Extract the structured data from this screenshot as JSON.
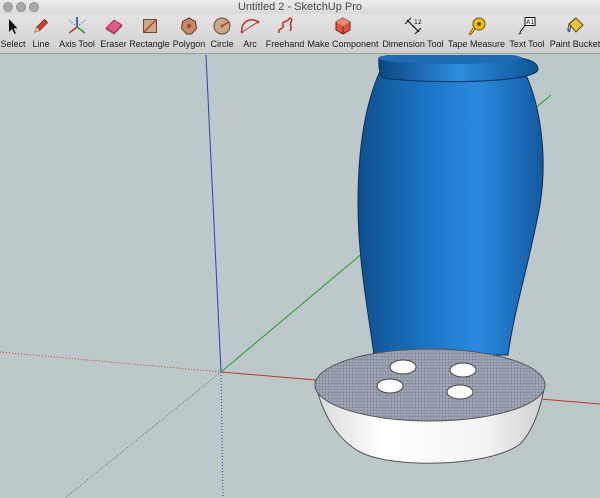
{
  "window": {
    "title": "Untitled 2 - SketchUp Pro"
  },
  "toolbar": {
    "tools": [
      {
        "label": "Select",
        "icon": "select-arrow-icon"
      },
      {
        "label": "Line",
        "icon": "pencil-icon"
      },
      {
        "label": "Axis Tool",
        "icon": "axis-icon"
      },
      {
        "label": "Eraser",
        "icon": "eraser-icon"
      },
      {
        "label": "Rectangle",
        "icon": "rectangle-icon"
      },
      {
        "label": "Polygon",
        "icon": "polygon-icon"
      },
      {
        "label": "Circle",
        "icon": "circle-icon"
      },
      {
        "label": "Arc",
        "icon": "arc-icon"
      },
      {
        "label": "Freehand",
        "icon": "freehand-icon"
      },
      {
        "label": "Make Component",
        "icon": "component-icon"
      },
      {
        "label": "Dimension Tool",
        "icon": "dimension-icon"
      },
      {
        "label": "Tape Measure",
        "icon": "tape-measure-icon"
      },
      {
        "label": "Text Tool",
        "icon": "text-tool-icon"
      },
      {
        "label": "Paint Bucket",
        "icon": "paint-bucket-icon"
      }
    ]
  },
  "colors": {
    "viewport_bg": "#bcc8ca",
    "axis_red": "#c0392b",
    "axis_green": "#2e9a2e",
    "axis_blue": "#2b3fc4",
    "vase_blue": "#1f78c8",
    "planter_white": "#f4f4f4"
  }
}
